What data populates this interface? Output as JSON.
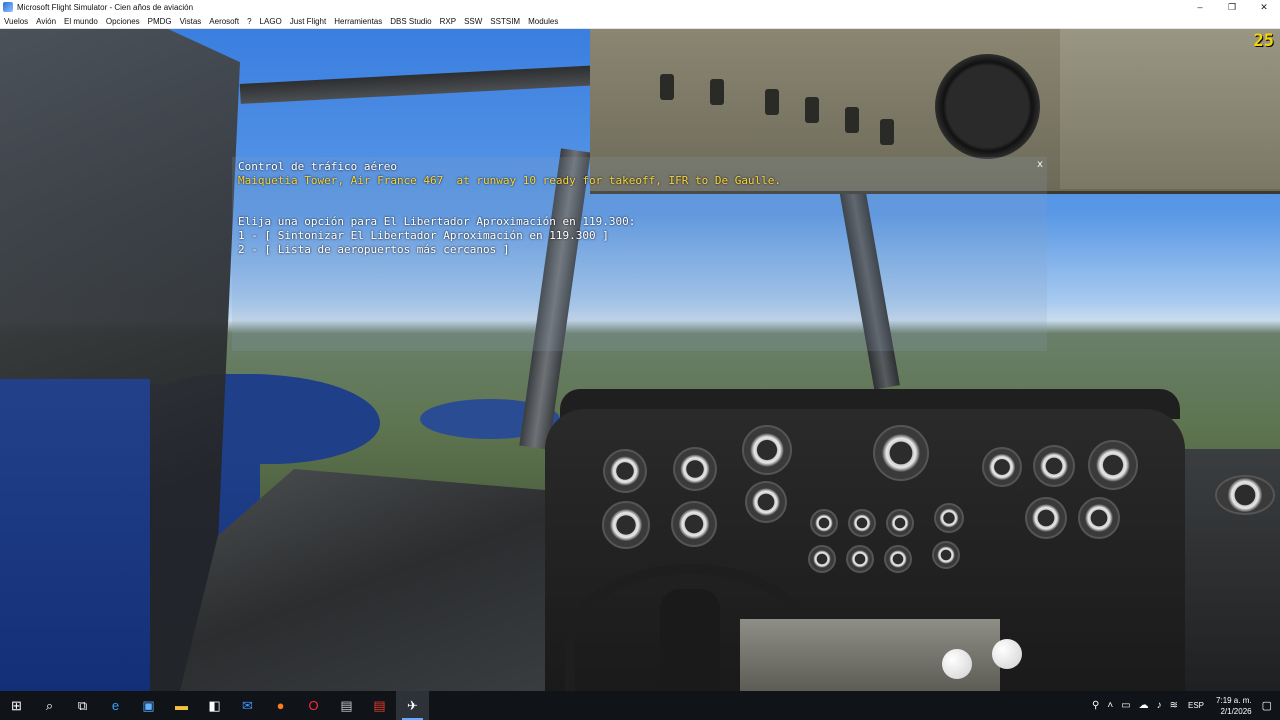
{
  "window": {
    "title": "Microsoft Flight Simulator - Cien años de aviación",
    "controls": [
      "–",
      "❐",
      "✕"
    ]
  },
  "menu": [
    "Vuelos",
    "Avión",
    "El mundo",
    "Opciones",
    "PMDG",
    "Vistas",
    "Aerosoft",
    "?",
    "LAGO",
    "Just Flight",
    "Herramientas",
    "DBS Studio",
    "RXP",
    "SSW",
    "SSTSIM",
    "Modules"
  ],
  "fps": "25",
  "atc": {
    "header": "Control de tráfico aéreo",
    "transmission": "Maiquetia Tower, Air France 467  at runway 10 ready for takeoff, IFR to De Gaulle.",
    "prompt": "Elija una opción para El Libertador Aproximación en 119.300:",
    "options": [
      "1 - [ Sintonizar El Libertador Aproximación en 119.300 ]",
      "2 - [ Lista de aeropuertos más cercanos ]"
    ],
    "close": "x",
    "text_color": "#ffffff",
    "transmission_color": "#f5d33a"
  },
  "taskbar": {
    "icons": [
      "windows-start-icon",
      "search-icon",
      "task-view-icon",
      "edge-icon",
      "store-icon",
      "file-explorer-icon",
      "store-bag-icon",
      "mail-icon",
      "firefox-icon",
      "opera-icon",
      "app-icon",
      "app-red-icon",
      "flight-sim-icon"
    ],
    "language": "ESP",
    "time": "7:19 a. m.",
    "date": "2/1/2026"
  }
}
